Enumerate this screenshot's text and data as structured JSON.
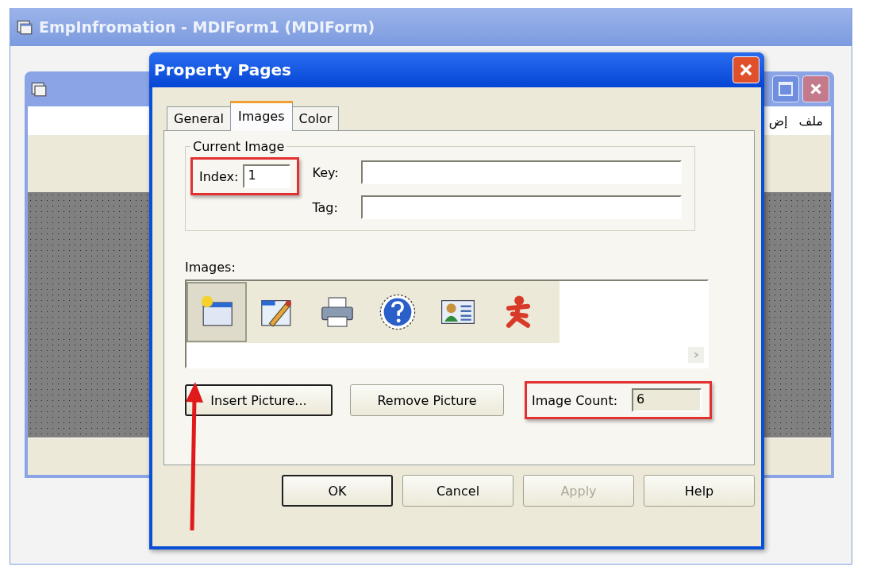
{
  "main_window": {
    "title": "EmpInfromation - MDIForm1 (MDIForm)"
  },
  "child_window": {
    "menu": [
      "ملف",
      "إض"
    ]
  },
  "dialog": {
    "title": "Property Pages",
    "tabs": [
      {
        "label": "General",
        "selected": false
      },
      {
        "label": "Images",
        "selected": true
      },
      {
        "label": "Color",
        "selected": false
      }
    ],
    "current_image": {
      "legend": "Current Image",
      "index_label": "Index:",
      "index_value": "1",
      "index_highlighted": true,
      "key_label": "Key:",
      "tag_label": "Tag:"
    },
    "images_label": "Images:",
    "images": [
      {
        "kind": "window",
        "selected": true
      },
      {
        "kind": "edit",
        "selected": false
      },
      {
        "kind": "printer",
        "selected": false
      },
      {
        "kind": "help",
        "selected": false
      },
      {
        "kind": "card",
        "selected": false
      },
      {
        "kind": "figure",
        "selected": false
      }
    ],
    "insert_button": {
      "label": "Insert Picture...",
      "focused": true
    },
    "remove_button": {
      "label": "Remove Picture"
    },
    "image_count": {
      "label": "Image Count:",
      "value": "6",
      "highlighted": true
    },
    "buttons": [
      {
        "label": "OK",
        "default": true,
        "disabled": false
      },
      {
        "label": "Cancel",
        "default": false,
        "disabled": false
      },
      {
        "label": "Apply",
        "default": false,
        "disabled": true
      },
      {
        "label": "Help",
        "default": false,
        "disabled": false
      }
    ]
  }
}
